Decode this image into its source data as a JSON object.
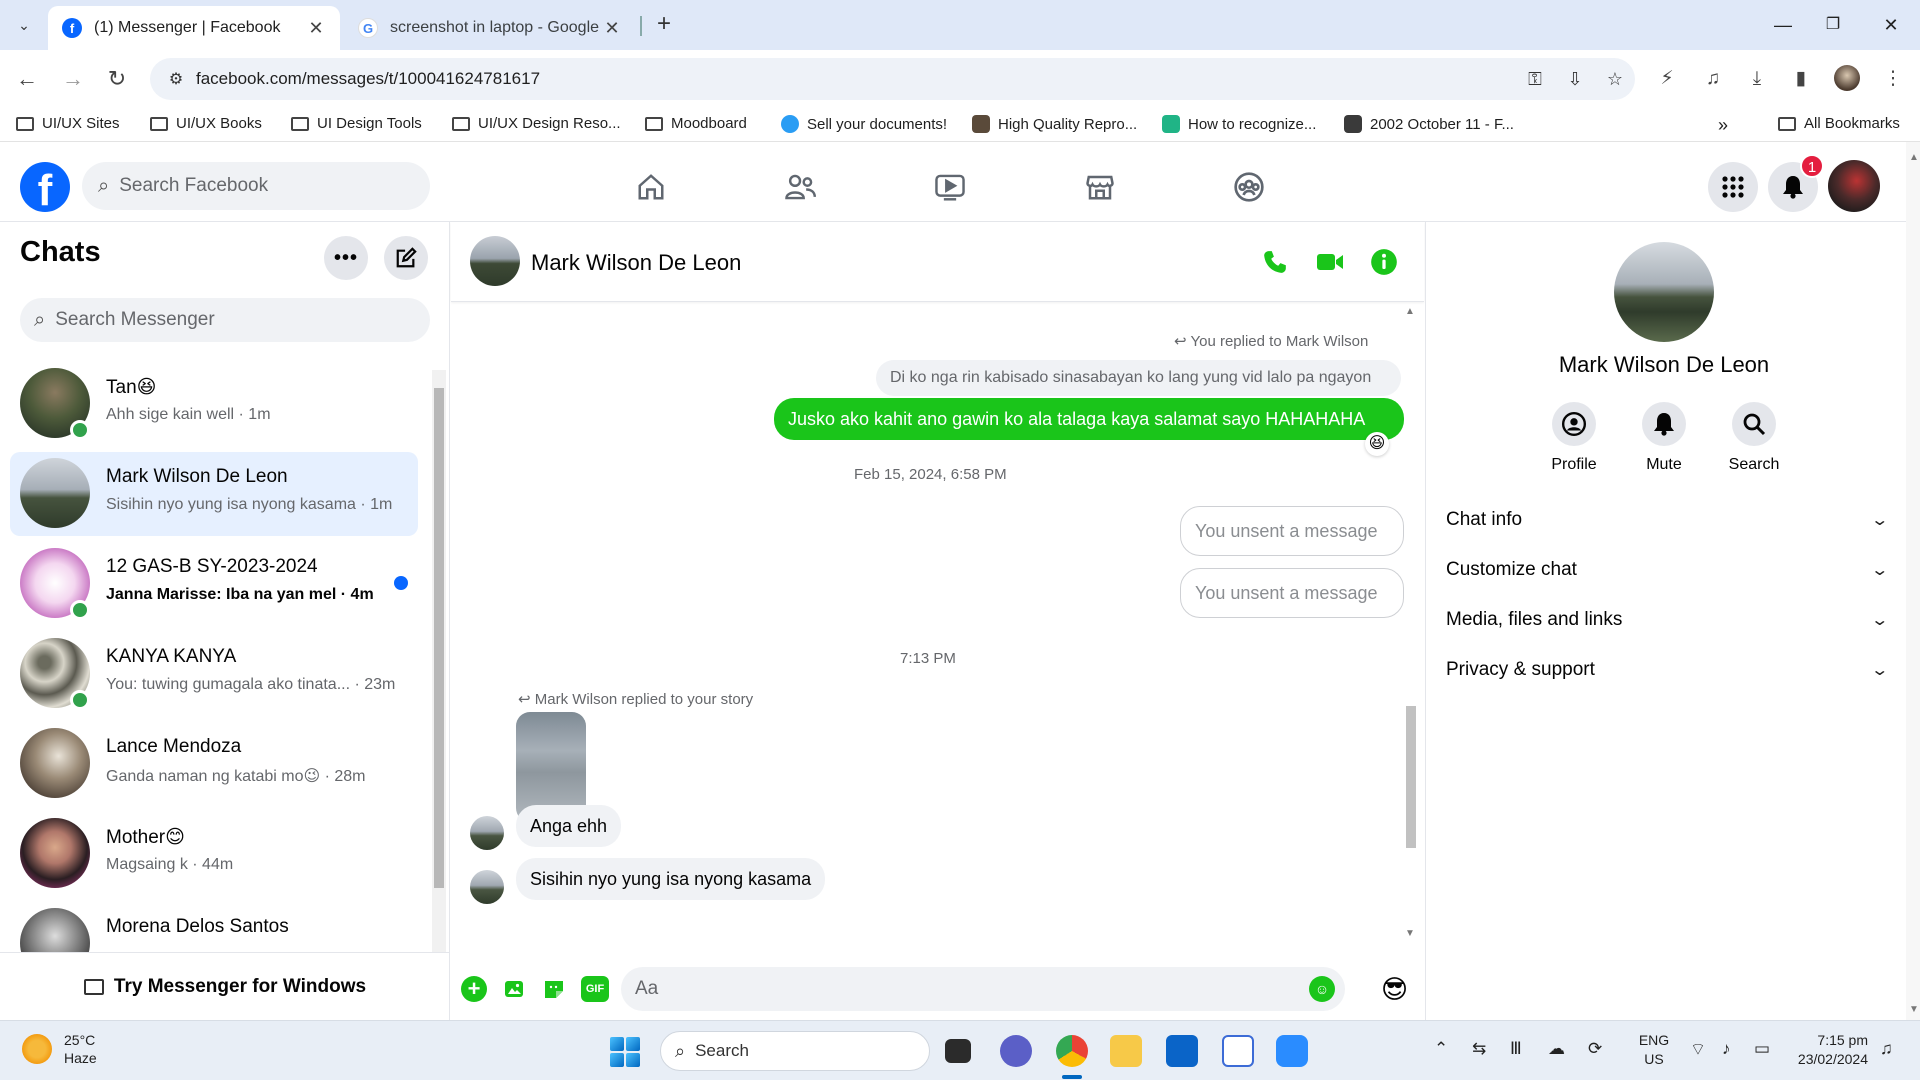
{
  "browser": {
    "tabs": [
      {
        "title": "(1) Messenger | Facebook",
        "active": true
      },
      {
        "title": "screenshot in laptop - Google S",
        "active": false
      }
    ],
    "url": "facebook.com/messages/t/100041624781617",
    "bookmarks": [
      {
        "label": "UI/UX Sites",
        "type": "folder"
      },
      {
        "label": "UI/UX Books",
        "type": "folder"
      },
      {
        "label": "UI Design Tools",
        "type": "folder"
      },
      {
        "label": "UI/UX Design Reso...",
        "type": "folder"
      },
      {
        "label": "Moodboard",
        "type": "folder"
      },
      {
        "label": "Sell your documents!",
        "type": "link"
      },
      {
        "label": "High Quality Repro...",
        "type": "link"
      },
      {
        "label": "How to recognize...",
        "type": "link"
      },
      {
        "label": "2002 October 11 - F...",
        "type": "link"
      },
      {
        "label": "All Bookmarks",
        "type": "folder"
      }
    ]
  },
  "facebook": {
    "search_placeholder": "Search Facebook",
    "notification_count": "1"
  },
  "chats": {
    "title": "Chats",
    "search_placeholder": "Search Messenger",
    "items": [
      {
        "name": "Tan😆",
        "preview": "Ahh sige kain well · 1m",
        "online": true,
        "selected": false,
        "unread": false
      },
      {
        "name": "Mark Wilson De Leon",
        "preview": "Sisihin nyo yung isa nyong kasama · 1m",
        "online": false,
        "selected": true,
        "unread": false
      },
      {
        "name": "12 GAS-B SY-2023-2024",
        "preview": "Janna Marisse: Iba na yan mel · 4m",
        "online": true,
        "selected": false,
        "unread": true
      },
      {
        "name": "KANYA KANYA",
        "preview": "You: tuwing gumagala ako tinata... · 23m",
        "online": true,
        "selected": false,
        "unread": false
      },
      {
        "name": "Lance Mendoza",
        "preview": "Ganda naman ng katabi mo😉 · 28m",
        "online": false,
        "selected": false,
        "unread": false
      },
      {
        "name": "Mother😊",
        "preview": "Magsaing k · 44m",
        "online": false,
        "selected": false,
        "unread": false
      },
      {
        "name": "Morena Delos Santos",
        "preview": "",
        "online": false,
        "selected": false,
        "unread": false
      }
    ],
    "try_messenger": "Try Messenger for Windows"
  },
  "conversation": {
    "contact_name": "Mark Wilson De Leon",
    "you_replied_note": "You replied to Mark Wilson",
    "quoted_text": "Di ko nga rin kabisado sinasabayan ko lang yung vid lalo pa ngayon",
    "my_message": "Jusko ako kahit ano gawin ko ala talaga kaya salamat sayo HAHAHAHA",
    "reaction": "😆",
    "timestamp_1": "Feb 15, 2024, 6:58 PM",
    "unsent_1": "You unsent a message",
    "unsent_2": "You unsent a message",
    "timestamp_2": "7:13 PM",
    "story_reply_note": "Mark Wilson replied to your story",
    "their_message_1": "Anga ehh",
    "their_message_2": "Sisihin nyo yung isa nyong kasama",
    "composer_placeholder": "Aa",
    "quick_reaction": "😎"
  },
  "info_panel": {
    "name": "Mark Wilson De Leon",
    "actions": [
      {
        "label": "Profile",
        "icon": "profile-icon"
      },
      {
        "label": "Mute",
        "icon": "bell-icon"
      },
      {
        "label": "Search",
        "icon": "search-icon"
      }
    ],
    "sections": [
      "Chat info",
      "Customize chat",
      "Media, files and links",
      "Privacy & support"
    ]
  },
  "taskbar": {
    "temperature": "25°C",
    "weather": "Haze",
    "search_label": "Search",
    "lang_line1": "ENG",
    "lang_line2": "US",
    "time": "7:15 pm",
    "date": "23/02/2024"
  },
  "colors": {
    "fb_blue": "#0866ff",
    "accent_green": "#1ac51a",
    "online": "#31a24c",
    "badge_red": "#e41e3f"
  }
}
